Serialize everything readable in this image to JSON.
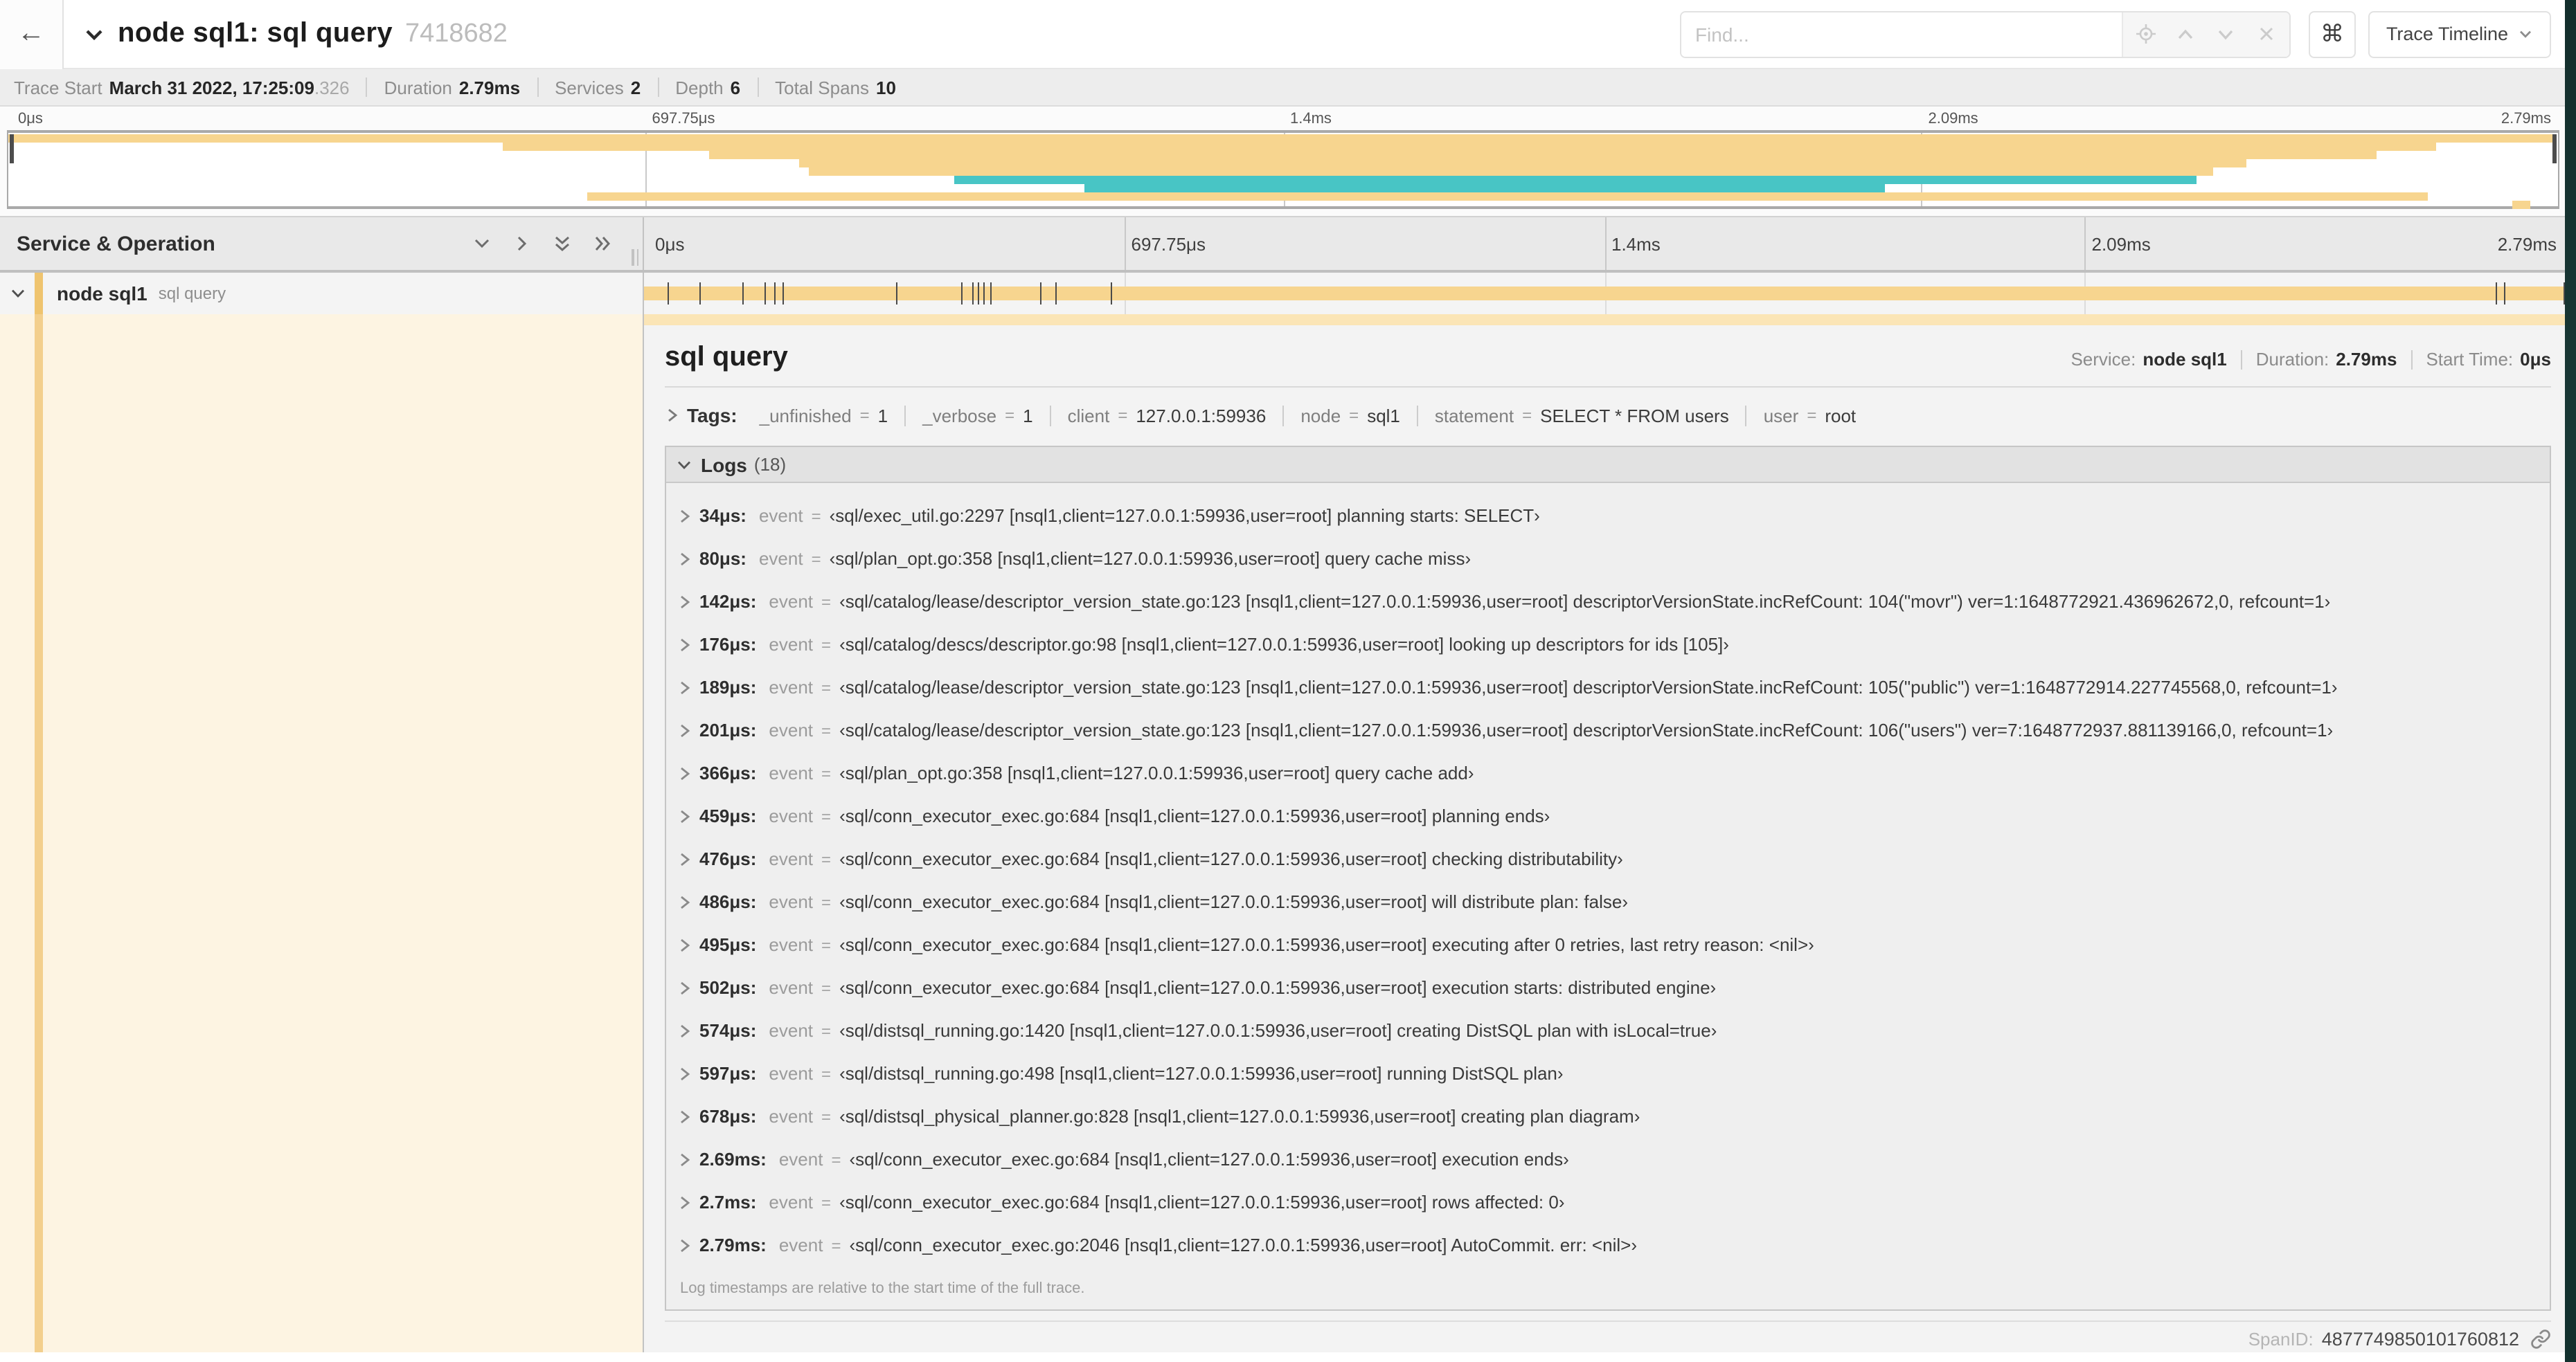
{
  "header": {
    "back_icon": "←",
    "title": "node sql1: sql query",
    "trace_id": "7418682",
    "find_placeholder": "Find...",
    "shortcut_button": "⌘",
    "view_selector": "Trace Timeline"
  },
  "summary": {
    "items": [
      {
        "label": "Trace Start",
        "value": "March 31 2022, 17:25:09",
        "suffix": ".326"
      },
      {
        "label": "Duration",
        "value": "2.79ms",
        "suffix": ""
      },
      {
        "label": "Services",
        "value": "2",
        "suffix": ""
      },
      {
        "label": "Depth",
        "value": "6",
        "suffix": ""
      },
      {
        "label": "Total Spans",
        "value": "10",
        "suffix": ""
      }
    ]
  },
  "ruler": {
    "ticks": [
      {
        "label": "0μs",
        "pct": 0
      },
      {
        "label": "697.75μs",
        "pct": 25
      },
      {
        "label": "1.4ms",
        "pct": 50
      },
      {
        "label": "2.09ms",
        "pct": 75
      },
      {
        "label": "2.79ms",
        "pct": 100
      }
    ]
  },
  "minimap": {
    "colors": {
      "tan": "#f7d58f",
      "teal": "#48c5c5"
    },
    "spans": [
      {
        "row": 0,
        "color": "tan",
        "start": 0,
        "end": 99.8
      },
      {
        "row": 1,
        "color": "tan",
        "start": 19.4,
        "end": 95.2
      },
      {
        "row": 2,
        "color": "tan",
        "start": 27.5,
        "end": 92.9
      },
      {
        "row": 3,
        "color": "tan",
        "start": 31.0,
        "end": 87.8
      },
      {
        "row": 4,
        "color": "tan",
        "start": 31.4,
        "end": 86.5
      },
      {
        "row": 5,
        "color": "teal",
        "start": 37.1,
        "end": 85.8
      },
      {
        "row": 6,
        "color": "teal",
        "start": 42.2,
        "end": 73.6
      },
      {
        "row": 7,
        "color": "tan",
        "start": 22.7,
        "end": 94.9
      },
      {
        "row": 8,
        "color": "tan",
        "start": 98.2,
        "end": 98.9
      }
    ]
  },
  "timeline": {
    "column_header": "Service & Operation",
    "row": {
      "service": "node sql1",
      "operation": "sql query"
    },
    "log_marker_pcts": [
      1.2,
      2.9,
      5.1,
      6.3,
      6.8,
      7.2,
      13.1,
      16.5,
      17.1,
      17.4,
      17.7,
      18.0,
      20.6,
      21.4,
      24.3,
      96.4,
      96.8,
      99.9
    ]
  },
  "detail": {
    "title": "sql query",
    "stats": [
      {
        "label": "Service:",
        "value": "node sql1"
      },
      {
        "label": "Duration:",
        "value": "2.79ms"
      },
      {
        "label": "Start Time:",
        "value": "0μs"
      }
    ],
    "tags": {
      "label": "Tags:",
      "items": [
        {
          "key": "_unfinished",
          "value": "1"
        },
        {
          "key": "_verbose",
          "value": "1"
        },
        {
          "key": "client",
          "value": "127.0.0.1:59936"
        },
        {
          "key": "node",
          "value": "sql1"
        },
        {
          "key": "statement",
          "value": "SELECT * FROM users"
        },
        {
          "key": "user",
          "value": "root"
        }
      ]
    },
    "logs": {
      "label": "Logs",
      "count": "(18)",
      "field_key": "event",
      "entries": [
        {
          "time": "34μs:",
          "value": "‹sql/exec_util.go:2297 [nsql1,client=127.0.0.1:59936,user=root] planning starts: SELECT›"
        },
        {
          "time": "80μs:",
          "value": "‹sql/plan_opt.go:358 [nsql1,client=127.0.0.1:59936,user=root] query cache miss›"
        },
        {
          "time": "142μs:",
          "value": "‹sql/catalog/lease/descriptor_version_state.go:123 [nsql1,client=127.0.0.1:59936,user=root] descriptorVersionState.incRefCount: 104(\"movr\") ver=1:1648772921.436962672,0, refcount=1›"
        },
        {
          "time": "176μs:",
          "value": "‹sql/catalog/descs/descriptor.go:98 [nsql1,client=127.0.0.1:59936,user=root] looking up descriptors for ids [105]›"
        },
        {
          "time": "189μs:",
          "value": "‹sql/catalog/lease/descriptor_version_state.go:123 [nsql1,client=127.0.0.1:59936,user=root] descriptorVersionState.incRefCount: 105(\"public\") ver=1:1648772914.227745568,0, refcount=1›"
        },
        {
          "time": "201μs:",
          "value": "‹sql/catalog/lease/descriptor_version_state.go:123 [nsql1,client=127.0.0.1:59936,user=root] descriptorVersionState.incRefCount: 106(\"users\") ver=7:1648772937.881139166,0, refcount=1›"
        },
        {
          "time": "366μs:",
          "value": "‹sql/plan_opt.go:358 [nsql1,client=127.0.0.1:59936,user=root] query cache add›"
        },
        {
          "time": "459μs:",
          "value": "‹sql/conn_executor_exec.go:684 [nsql1,client=127.0.0.1:59936,user=root] planning ends›"
        },
        {
          "time": "476μs:",
          "value": "‹sql/conn_executor_exec.go:684 [nsql1,client=127.0.0.1:59936,user=root] checking distributability›"
        },
        {
          "time": "486μs:",
          "value": "‹sql/conn_executor_exec.go:684 [nsql1,client=127.0.0.1:59936,user=root] will distribute plan: false›"
        },
        {
          "time": "495μs:",
          "value": "‹sql/conn_executor_exec.go:684 [nsql1,client=127.0.0.1:59936,user=root] executing after 0 retries, last retry reason: <nil>›"
        },
        {
          "time": "502μs:",
          "value": "‹sql/conn_executor_exec.go:684 [nsql1,client=127.0.0.1:59936,user=root] execution starts: distributed engine›"
        },
        {
          "time": "574μs:",
          "value": "‹sql/distsql_running.go:1420 [nsql1,client=127.0.0.1:59936,user=root] creating DistSQL plan with isLocal=true›"
        },
        {
          "time": "597μs:",
          "value": "‹sql/distsql_running.go:498 [nsql1,client=127.0.0.1:59936,user=root] running DistSQL plan›"
        },
        {
          "time": "678μs:",
          "value": "‹sql/distsql_physical_planner.go:828 [nsql1,client=127.0.0.1:59936,user=root] creating plan diagram›"
        },
        {
          "time": "2.69ms:",
          "value": "‹sql/conn_executor_exec.go:684 [nsql1,client=127.0.0.1:59936,user=root] execution ends›"
        },
        {
          "time": "2.7ms:",
          "value": "‹sql/conn_executor_exec.go:684 [nsql1,client=127.0.0.1:59936,user=root] rows affected: 0›"
        },
        {
          "time": "2.79ms:",
          "value": "‹sql/conn_executor_exec.go:2046 [nsql1,client=127.0.0.1:59936,user=root] AutoCommit. err: <nil>›"
        }
      ],
      "footnote": "Log timestamps are relative to the start time of the full trace."
    },
    "span_id_label": "SpanID:",
    "span_id": "4877749850101760812"
  }
}
